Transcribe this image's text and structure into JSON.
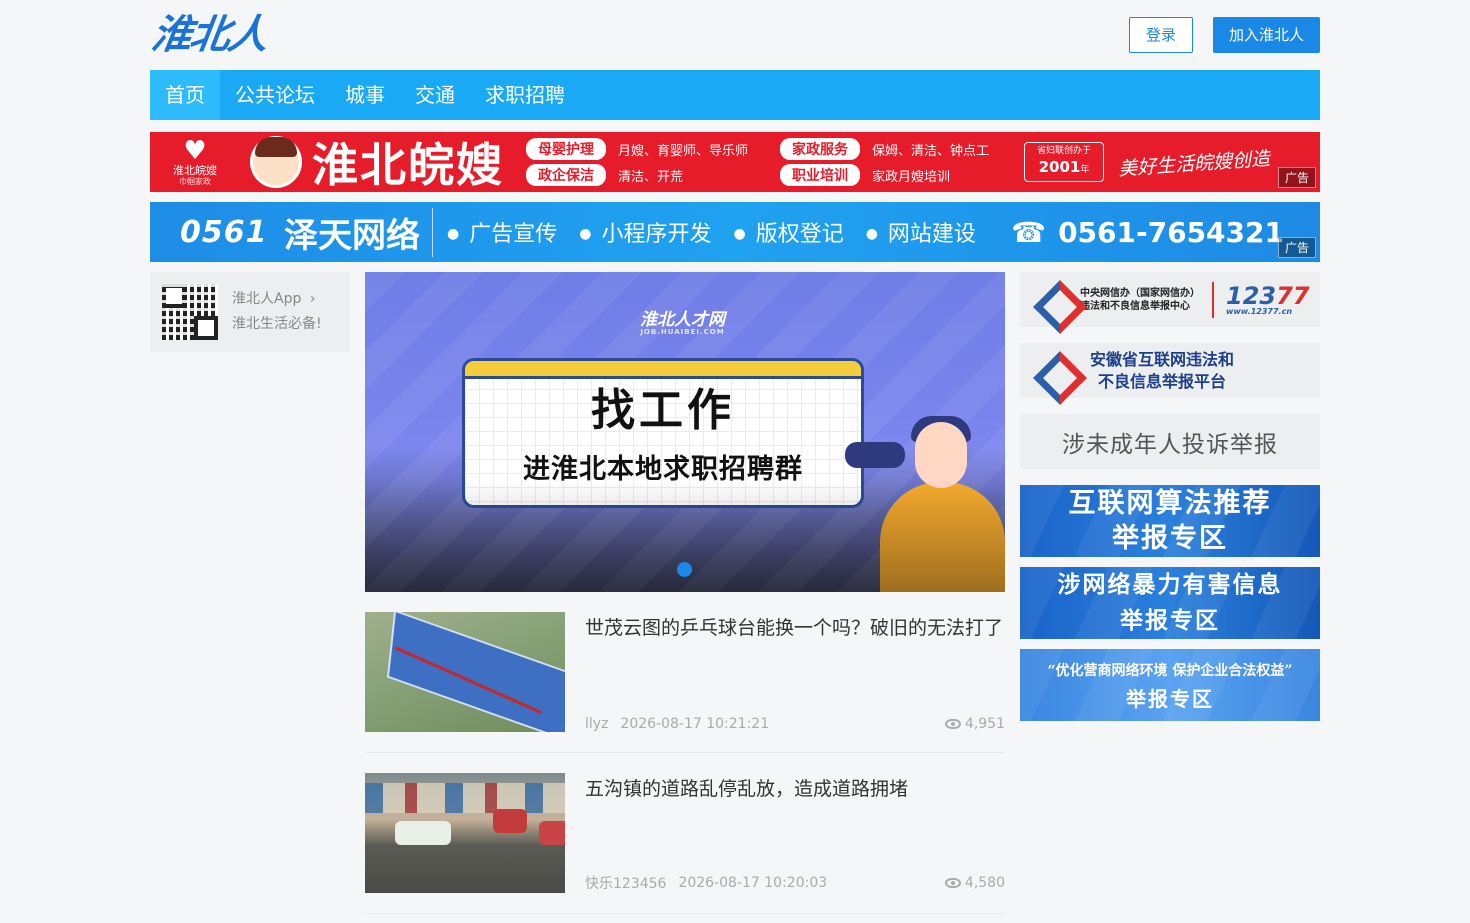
{
  "header": {
    "logo_text": "淮北人",
    "login_label": "登录",
    "join_label": "加入淮北人"
  },
  "nav": {
    "items": [
      {
        "label": "首页",
        "active": true
      },
      {
        "label": "公共论坛",
        "active": false
      },
      {
        "label": "城事",
        "active": false
      },
      {
        "label": "交通",
        "active": false
      },
      {
        "label": "求职招聘",
        "active": false
      }
    ]
  },
  "banner1": {
    "logo_text": "淮北皖嫂",
    "logo_sub": "巾帼家政",
    "title": "淮北皖嫂",
    "pill1": "母婴护理",
    "text1": "月嫂、育婴师、导乐师",
    "pill2": "家政服务",
    "text2": "保姆、清洁、钟点工",
    "pill3": "政企保洁",
    "text3": "清洁、开荒",
    "pill4": "职业培训",
    "text4": "家政月嫂培训",
    "since_line1": "省妇联创办于",
    "since_year": "2001",
    "since_unit": "年",
    "slogan": "美好生活皖嫂创造",
    "ad_tag": "广告"
  },
  "banner2": {
    "logo_text": "0561",
    "brand": "泽天网络",
    "items": [
      "广告宣传",
      "小程序开发",
      "版权登记",
      "网站建设"
    ],
    "phone": "0561-7654321",
    "ad_tag": "广告"
  },
  "app_card": {
    "title": "淮北人App",
    "subtitle": "淮北生活必备!"
  },
  "slider": {
    "logo_text": "淮北人才网",
    "logo_sub": "JOB.HUAIBEI.COM",
    "headline": "找工作",
    "subline": "进淮北本地求职招聘群"
  },
  "news": [
    {
      "title": "世茂云图的乒乓球台能换一个吗？破旧的无法打了",
      "author": "llyz",
      "time": "2026-08-17 10:21:21",
      "views": "4,951"
    },
    {
      "title": "五沟镇的道路乱停乱放，造成道路拥堵",
      "author": "快乐123456",
      "time": "2026-08-17 10:20:03",
      "views": "4,580"
    }
  ],
  "sidebar": {
    "r1_line1": "中央网信办（国家网信办）",
    "r1_line2": "违法和不良信息举报中心",
    "r1_num_a": "123",
    "r1_num_b": "77",
    "r1_url": "www.12377.cn",
    "r2_line1": "安徽省互联网违法和",
    "r2_line2": "不良信息举报平台",
    "r3_text": "涉未成年人投诉举报",
    "r4_line1": "互联网算法推荐",
    "r4_line2": "举报专区",
    "r5_line1": "涉网络暴力有害信息",
    "r5_line2": "举报专区",
    "r6_line1": "“优化营商网络环境 保护企业合法权益”",
    "r6_line2": "举报专区"
  },
  "colors": {
    "nav_bg": "#19a9f5",
    "accent": "#1a88e6",
    "banner_red": "#e61c2a"
  }
}
